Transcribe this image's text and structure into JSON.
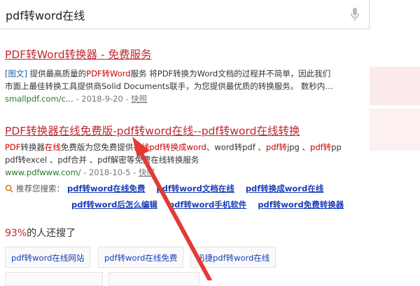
{
  "search": {
    "query": "pdf转word在线"
  },
  "results": [
    {
      "title": "PDF转Word转换器 - 免费服务",
      "line1": [
        "[图文]",
        " 提供最高质量的",
        "PDF转Word",
        "服务 将PDF转换为Word文档的过程并不简单，因此我们"
      ],
      "line2": "市面上最佳转换工具提供商Solid Documents联手，为您提供最优质的转换服务。 数秒内…",
      "url": "smallpdf.com/c...",
      "date": " - 2018-9-20 - ",
      "snapshot": "快照"
    },
    {
      "title": "PDF转换器在线免费版-pdf转word在线--pdf转word在线转换",
      "line1": [
        "PDF",
        "转换器",
        "在线",
        "免费版为您免费提供",
        "在线",
        "pdf转换成word",
        "、word转pdf 、",
        "pdf转",
        "jpg 、",
        "pdf转",
        "pp"
      ],
      "line2": "pdf转excel 、pdf合并 、pdf解密等免费在线转换服务",
      "url": "www.pdfwww.com/",
      "date": " - 2018-10-5 - ",
      "snapshot": "快照"
    }
  ],
  "recommend": {
    "label": "推荐您搜索：",
    "row1": [
      "pdf转word在线免费",
      "pdf转word文档在线",
      "pdf转换成word在线"
    ],
    "row2": [
      "pdf转word后怎么编辑",
      "pdf转word手机软件",
      "pdf转word免费转换器"
    ]
  },
  "also": {
    "pct": "93%",
    "text": "的人还搜了"
  },
  "chips": [
    "pdf转word在线网站",
    "pdf转word在线免费",
    "迅捷pdf转word在线"
  ],
  "colors": {
    "title": "#c0282f",
    "link": "#1a3cb8",
    "url": "#2a7a2a",
    "highlight": "#cc0000",
    "arrow": "#e23b35"
  }
}
